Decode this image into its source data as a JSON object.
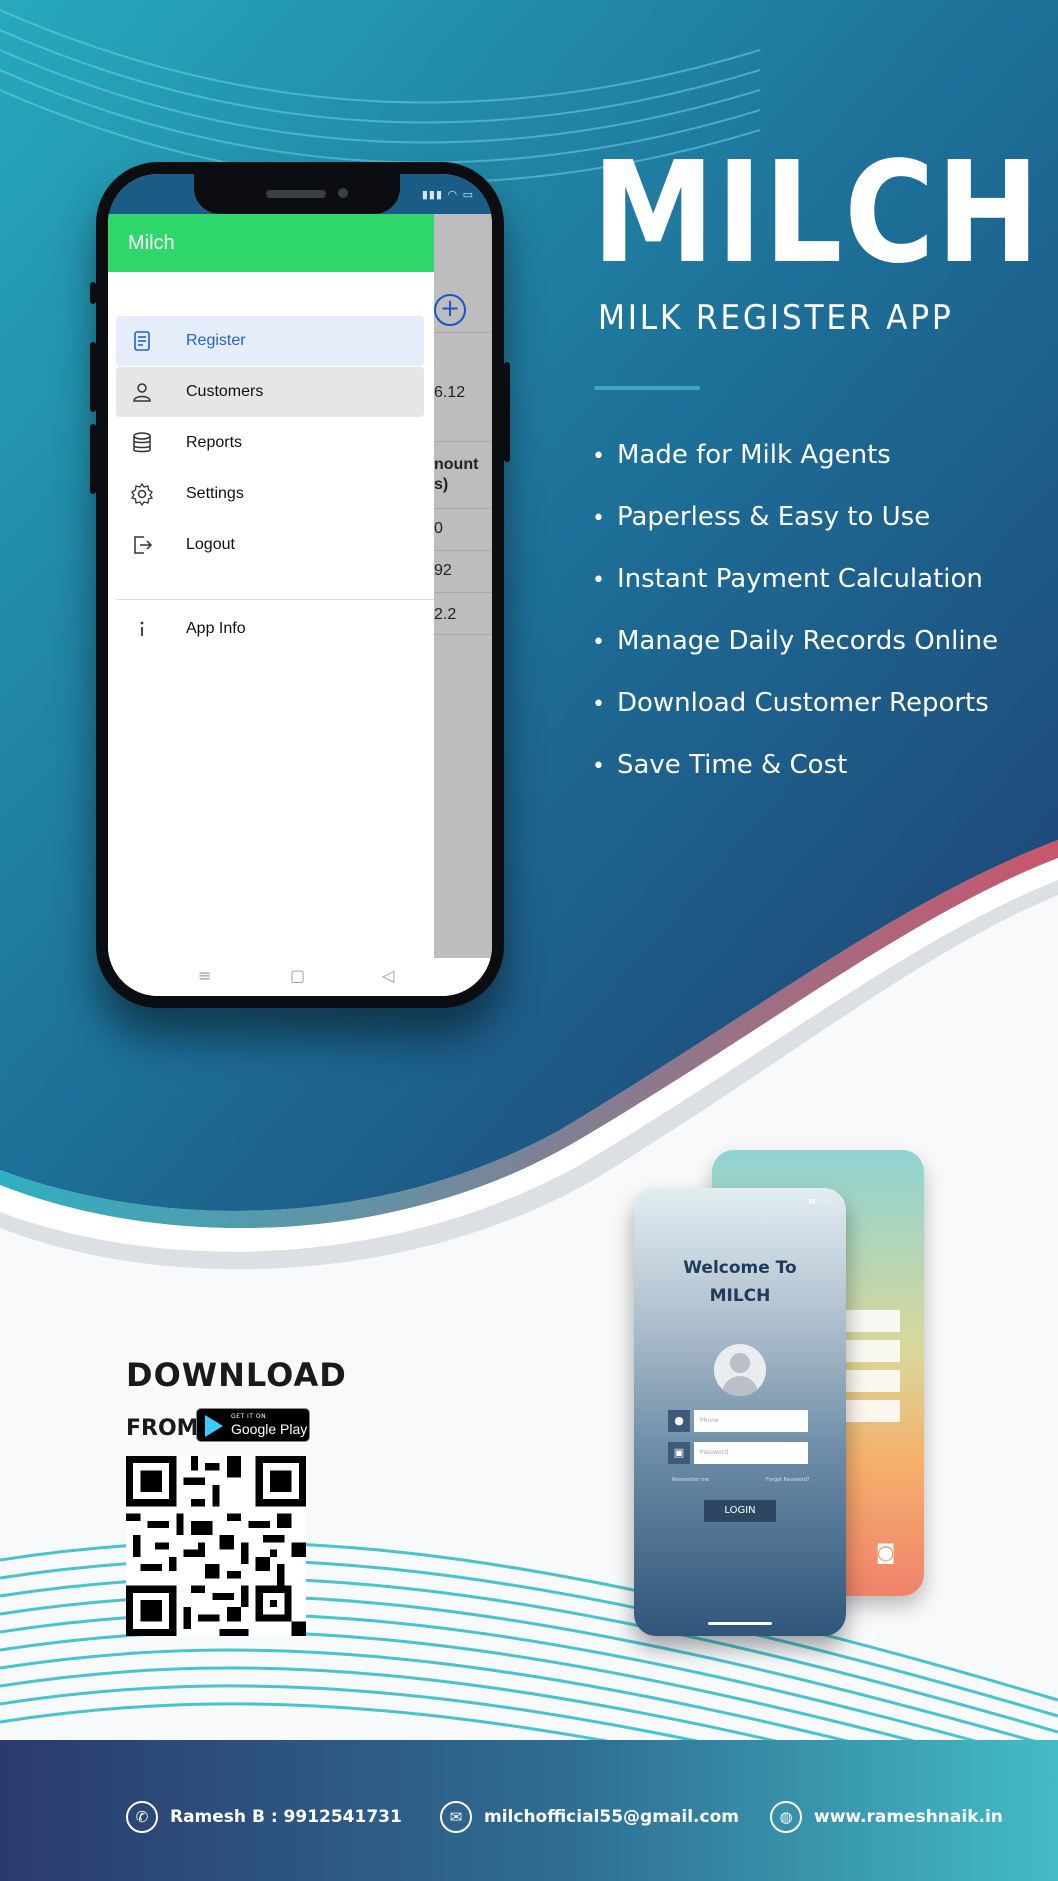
{
  "brand": {
    "title": "MILCH",
    "subtitle": "MILK REGISTER APP"
  },
  "features": [
    "Made for Milk Agents",
    "Paperless & Easy to Use",
    "Instant Payment Calculation",
    "Manage Daily Records Online",
    "Download Customer Reports",
    "Save Time & Cost"
  ],
  "app_screen": {
    "drawer_title": "Milch",
    "menu": [
      {
        "label": "Register",
        "icon": "document-icon",
        "state": "selected"
      },
      {
        "label": "Customers",
        "icon": "person-icon",
        "state": "hover"
      },
      {
        "label": "Reports",
        "icon": "database-icon",
        "state": "normal"
      },
      {
        "label": "Settings",
        "icon": "gear-icon",
        "state": "normal"
      },
      {
        "label": "Logout",
        "icon": "logout-icon",
        "state": "normal"
      },
      {
        "label": "App Info",
        "icon": "info-icon",
        "state": "normal"
      }
    ],
    "background_cells": [
      "6.12",
      "nount",
      "s)",
      "0",
      "92",
      "2.2"
    ],
    "colors": {
      "drawer_header": "#2fd66a",
      "selected_text": "#2560cc",
      "selected_bg": "#e5edfb"
    }
  },
  "download": {
    "heading": "DOWNLOAD",
    "from": "FROM",
    "store_small": "GET IT ON",
    "store_name": "Google Play"
  },
  "login_mockup": {
    "welcome_line1": "Welcome To",
    "welcome_line2": "MILCH",
    "phone_placeholder": "Phone",
    "password_placeholder": "Password",
    "remember": "Remember me",
    "forgot": "Forgot Password?",
    "login_button": "LOGIN"
  },
  "footer": {
    "phone": "Ramesh B : 9912541731",
    "email": "milchofficial55@gmail.com",
    "website": "www.rameshnaik.in"
  },
  "colors": {
    "primary_blue": "#1b4f7e",
    "teal": "#1f8ea6",
    "accent_pink": "#c8566c",
    "footer_start": "#2a3a6c",
    "footer_end": "#43bcc6"
  }
}
